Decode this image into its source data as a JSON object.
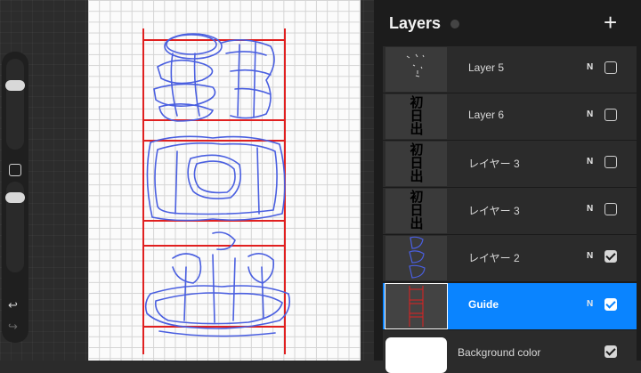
{
  "panel": {
    "title": "Layers",
    "add_label": "+",
    "layers": [
      {
        "name": "Layer 5",
        "blend": "N",
        "visible": false,
        "thumb_text": ""
      },
      {
        "name": "Layer 6",
        "blend": "N",
        "visible": false,
        "thumb_text": "初日出"
      },
      {
        "name": "レイヤー 3",
        "blend": "N",
        "visible": false,
        "thumb_text": "初日出"
      },
      {
        "name": "レイヤー 3",
        "blend": "N",
        "visible": false,
        "thumb_text": "初日出"
      },
      {
        "name": "レイヤー 2",
        "blend": "N",
        "visible": true,
        "thumb_text": ""
      },
      {
        "name": "Guide",
        "blend": "N",
        "visible": true,
        "thumb_text": "",
        "selected": true
      }
    ],
    "background": {
      "name": "Background color",
      "visible": true
    }
  },
  "sidebar": {
    "undo_icon": "undo-icon",
    "redo_icon": "redo-icon"
  },
  "colors": {
    "accent": "#0a84ff",
    "guide_red": "#e02020",
    "sketch_blue": "#4a5fe0"
  }
}
